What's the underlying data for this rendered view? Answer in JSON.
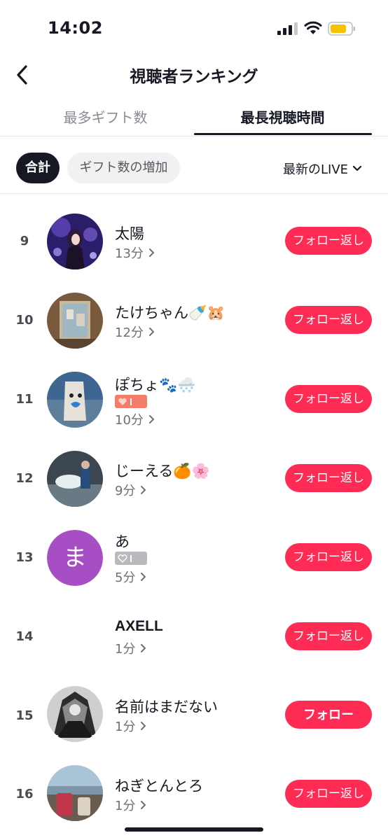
{
  "status_bar": {
    "time": "14:02"
  },
  "header": {
    "title": "視聴者ランキング",
    "back_icon": "chevron-left-icon"
  },
  "tabs": [
    {
      "label": "最多ギフト数",
      "active": false
    },
    {
      "label": "最長視聴時間",
      "active": true
    }
  ],
  "filters": {
    "chips": [
      {
        "label": "合計",
        "active": true
      },
      {
        "label": "ギフト数の増加",
        "active": false
      }
    ],
    "live_select": "最新のLIVE"
  },
  "colors": {
    "accent": "#fe2c55",
    "text": "#161823",
    "secondary": "#8a8b91"
  },
  "viewers": [
    {
      "rank": "9",
      "name": "太陽",
      "duration": "13分",
      "button": "フォロー返し",
      "badge": null
    },
    {
      "rank": "10",
      "name": "たけちゃん🍼🐹",
      "duration": "12分",
      "button": "フォロー返し",
      "badge": null
    },
    {
      "rank": "11",
      "name": "ぽちょ🐾🌨️",
      "duration": "10分",
      "button": "フォロー返し",
      "badge": "orange"
    },
    {
      "rank": "12",
      "name": "じーえる🍊🌸",
      "duration": "9分",
      "button": "フォロー返し",
      "badge": null
    },
    {
      "rank": "13",
      "name": "あ",
      "duration": "5分",
      "button": "フォロー返し",
      "badge": "gray",
      "avatar_letter": "ま"
    },
    {
      "rank": "14",
      "name": "AXELL",
      "duration": "1分",
      "button": "フォロー返し",
      "badge": null
    },
    {
      "rank": "15",
      "name": "名前はまだない",
      "duration": "1分",
      "button": "フォロー",
      "badge": null
    },
    {
      "rank": "16",
      "name": "ねぎとんとろ",
      "duration": "1分",
      "button": "フォロー返し",
      "badge": null
    }
  ]
}
